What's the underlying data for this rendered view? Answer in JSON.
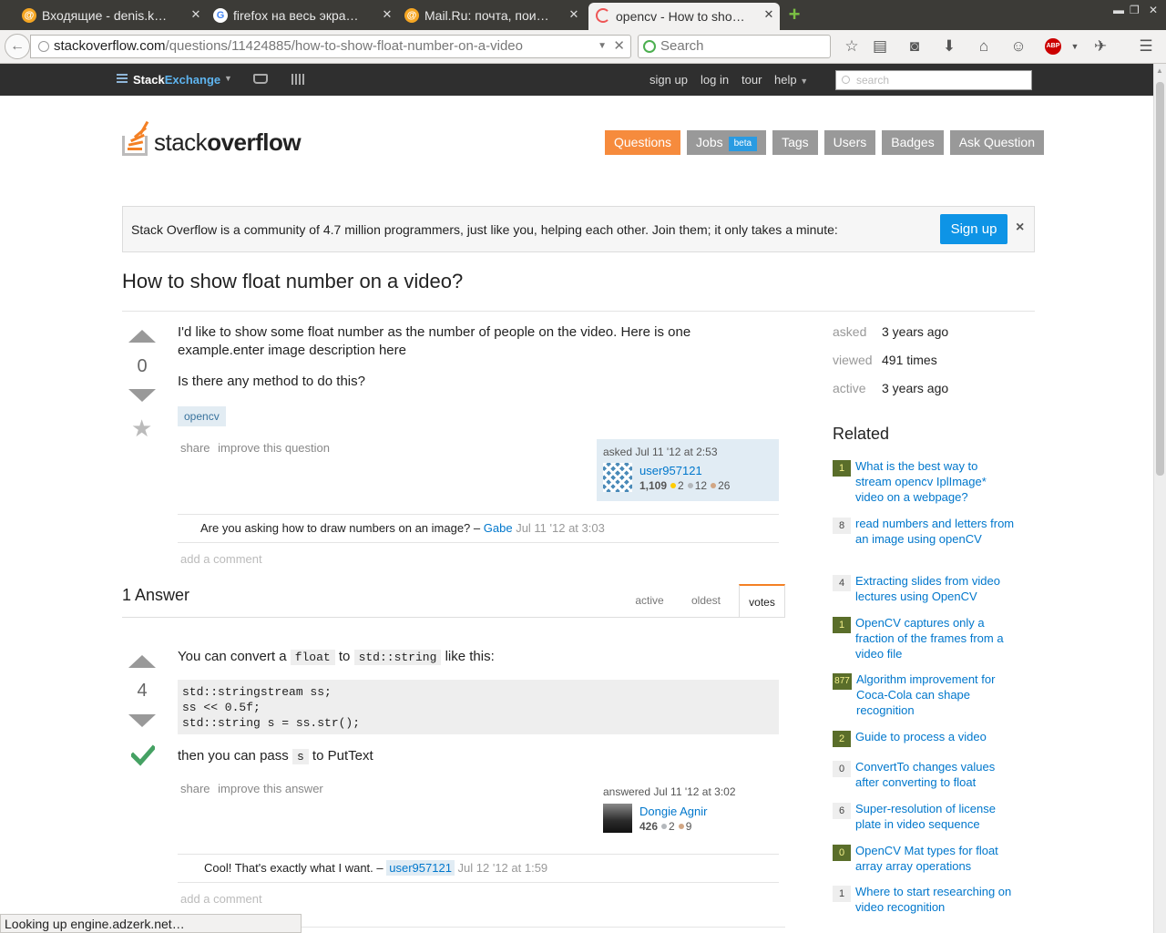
{
  "browser": {
    "tabs": [
      {
        "title": "Входящие - denis.k…",
        "icon": "mailru-at-icon",
        "active": false
      },
      {
        "title": "firefox на весь экра…",
        "icon": "google-g-icon",
        "active": false
      },
      {
        "title": "Mail.Ru: почта, пои…",
        "icon": "mailru-at-icon",
        "active": false
      },
      {
        "title": "opencv - How to sho…",
        "icon": "loading-spinner-icon",
        "active": true
      }
    ],
    "url_host": "stackoverflow.com",
    "url_path": "/questions/11424885/how-to-show-float-number-on-a-video",
    "search_placeholder": "Search",
    "status_text": "Looking up engine.adzerk.net…",
    "abp_label": "ABP"
  },
  "se_bar": {
    "logo_stack": "Stack",
    "logo_exchange": "Exchange",
    "links": [
      "sign up",
      "log in",
      "tour",
      "help"
    ],
    "search_placeholder": "search"
  },
  "header": {
    "logo_stack": "stack",
    "logo_overflow": "overflow",
    "nav": [
      {
        "label": "Questions",
        "active": true
      },
      {
        "label": "Jobs",
        "badge": "beta"
      },
      {
        "label": "Tags"
      },
      {
        "label": "Users"
      },
      {
        "label": "Badges"
      },
      {
        "label": "Ask Question"
      }
    ]
  },
  "banner": {
    "text": "Stack Overflow is a community of 4.7 million programmers, just like you, helping each other. Join them; it only takes a minute:",
    "button": "Sign up",
    "close": "×"
  },
  "question": {
    "title": "How to show float number on a video?",
    "votes": "0",
    "body_p1": "I'd like to show some float number as the number of people on the video. Here is one example.enter image description here",
    "body_p2": "Is there any method to do this?",
    "tag": "opencv",
    "menu_share": "share",
    "menu_improve": "improve this question",
    "asked": "asked Jul 11 '12 at 2:53",
    "user": "user957121",
    "rep": "1,109",
    "gold": "2",
    "silver": "12",
    "bronze": "26",
    "comment_text": "Are you asking how to draw numbers on an image? –",
    "comment_user": "Gabe",
    "comment_date": "Jul 11 '12 at 3:03",
    "add_comment": "add a comment"
  },
  "answers": {
    "header": "1 Answer",
    "sort_tabs": [
      "active",
      "oldest",
      "votes"
    ],
    "active_sort": "votes",
    "answer": {
      "votes": "4",
      "text_before": "You can convert a",
      "code1": "float",
      "text_mid": "to",
      "code2": "std::string",
      "text_after": "like this:",
      "code_block": "std::stringstream ss;\nss << 0.5f;\nstd::string s = ss.str();",
      "text2_before": "then you can pass",
      "code3": "s",
      "text2_after": "to PutText",
      "menu_share": "share",
      "menu_improve": "improve this answer",
      "answered": "answered Jul 11 '12 at 3:02",
      "user": "Dongie Agnir",
      "rep": "426",
      "silver": "2",
      "bronze": "9",
      "comment_text": "Cool! That's exactly what I want. –",
      "comment_user": "user957121",
      "comment_date": "Jul 12 '12 at 1:59",
      "add_comment": "add a comment"
    }
  },
  "sidebar": {
    "meta": [
      {
        "label": "asked",
        "value": "3 years ago"
      },
      {
        "label": "viewed",
        "value": "491 times"
      },
      {
        "label": "active",
        "value": "3 years ago"
      }
    ],
    "related_title": "Related",
    "related": [
      {
        "score": "1",
        "answered": true,
        "title": "What is the best way to stream opencv IplImage* video on a webpage?"
      },
      {
        "score": "8",
        "answered": false,
        "title": "read numbers and letters from an image using openCV"
      },
      {
        "score": "4",
        "answered": false,
        "title": "Extracting slides from video lectures using OpenCV"
      },
      {
        "score": "1",
        "answered": true,
        "title": "OpenCV captures only a fraction of the frames from a video file"
      },
      {
        "score": "877",
        "answered": true,
        "title": "Algorithm improvement for Coca-Cola can shape recognition"
      },
      {
        "score": "2",
        "answered": true,
        "title": "Guide to process a video"
      },
      {
        "score": "0",
        "answered": false,
        "title": "ConvertTo changes values after converting to float"
      },
      {
        "score": "6",
        "answered": false,
        "title": "Super-resolution of license plate in video sequence"
      },
      {
        "score": "0",
        "answered": true,
        "title": "OpenCV Mat types for float array array operations"
      },
      {
        "score": "1",
        "answered": false,
        "title": "Where to start researching on video recognition"
      }
    ]
  },
  "colors": {
    "accent_orange": "#f48024",
    "link_blue": "#0077cc",
    "answered_green": "#5a6e2a",
    "accepted_check": "#45a163"
  }
}
